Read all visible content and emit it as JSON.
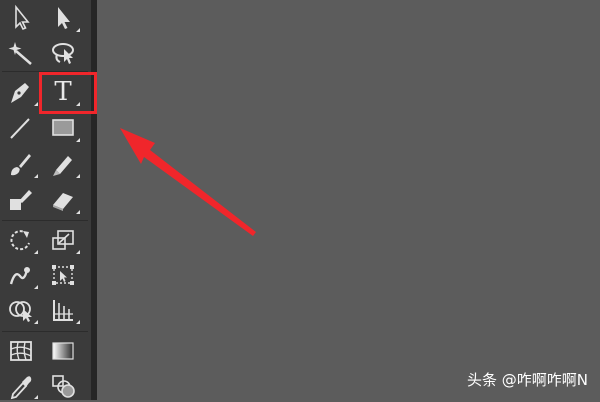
{
  "tools": {
    "selection": {
      "icon": "selection-arrow-icon"
    },
    "direct_selection": {
      "icon": "direct-selection-arrow-icon"
    },
    "magic_wand": {
      "icon": "magic-wand-icon"
    },
    "lasso": {
      "icon": "lasso-icon"
    },
    "pen": {
      "icon": "pen-icon"
    },
    "type": {
      "icon": "type-icon",
      "glyph": "T"
    },
    "line": {
      "icon": "line-segment-icon"
    },
    "rectangle": {
      "icon": "rectangle-icon"
    },
    "paintbrush": {
      "icon": "paintbrush-icon"
    },
    "pencil": {
      "icon": "pencil-icon"
    },
    "blob_brush": {
      "icon": "blob-brush-icon"
    },
    "eraser": {
      "icon": "eraser-icon"
    },
    "rotate": {
      "icon": "rotate-icon"
    },
    "scale": {
      "icon": "scale-icon"
    },
    "warp": {
      "icon": "warp-icon"
    },
    "free_transform": {
      "icon": "free-transform-icon"
    },
    "shape_builder": {
      "icon": "shape-builder-icon"
    },
    "perspective_grid": {
      "icon": "perspective-grid-icon"
    },
    "mesh": {
      "icon": "mesh-icon"
    },
    "gradient": {
      "icon": "gradient-icon"
    },
    "eyedropper": {
      "icon": "eyedropper-icon"
    },
    "blend": {
      "icon": "blend-icon"
    }
  },
  "annotation": {
    "highlight_color": "#f0262b"
  },
  "watermark": {
    "text": "头条 @咋啊咋啊N"
  },
  "colors": {
    "canvas": "#5c5c5c",
    "toolbar": "#3b3b3b",
    "icon": "#e0e0e0"
  }
}
